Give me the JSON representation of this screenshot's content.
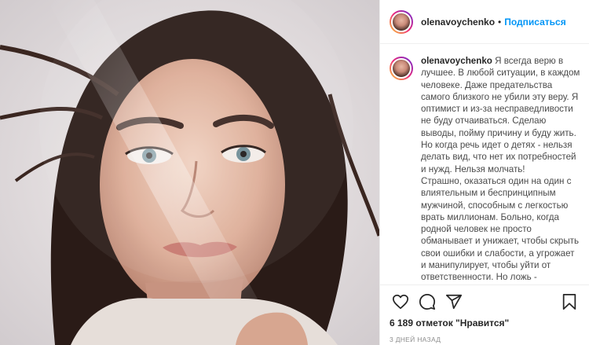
{
  "post": {
    "username": "olenavoychenko",
    "separator": "•",
    "follow_label": "Подписаться",
    "caption_paragraphs": [
      "Я всегда верю в лучшее. В любой ситуации, в каждом человеке. Даже предательства самого близкого не убили эту веру. Я оптимист и из-за несправедливости не буду отчаиваться. Сделаю выводы, пойму причину и буду жить. Но когда речь идет о детях - нельзя делать вид, что нет их потребностей и нужд. Нельзя молчать!",
      "Страшно, оказаться один на один с влиятельным и беспринципным мужчиной, способным с легкостью врать миллионам. Больно, когда родной человек не просто обманывает и унижает, чтобы скрыть свои ошибки и слабости, а угрожает и манипулирует, чтобы уйти от ответственности. Но ложь -"
    ],
    "likes_text": "6 189 отметок \"Нравится\"",
    "time_ago": "3 дней назад"
  },
  "icons": {
    "like": "heart-icon",
    "comment": "comment-icon",
    "share": "share-icon",
    "save": "bookmark-icon"
  },
  "colors": {
    "accent": "#0095f6",
    "text": "#262626",
    "muted": "#8e8e8e",
    "border": "#efefef"
  }
}
